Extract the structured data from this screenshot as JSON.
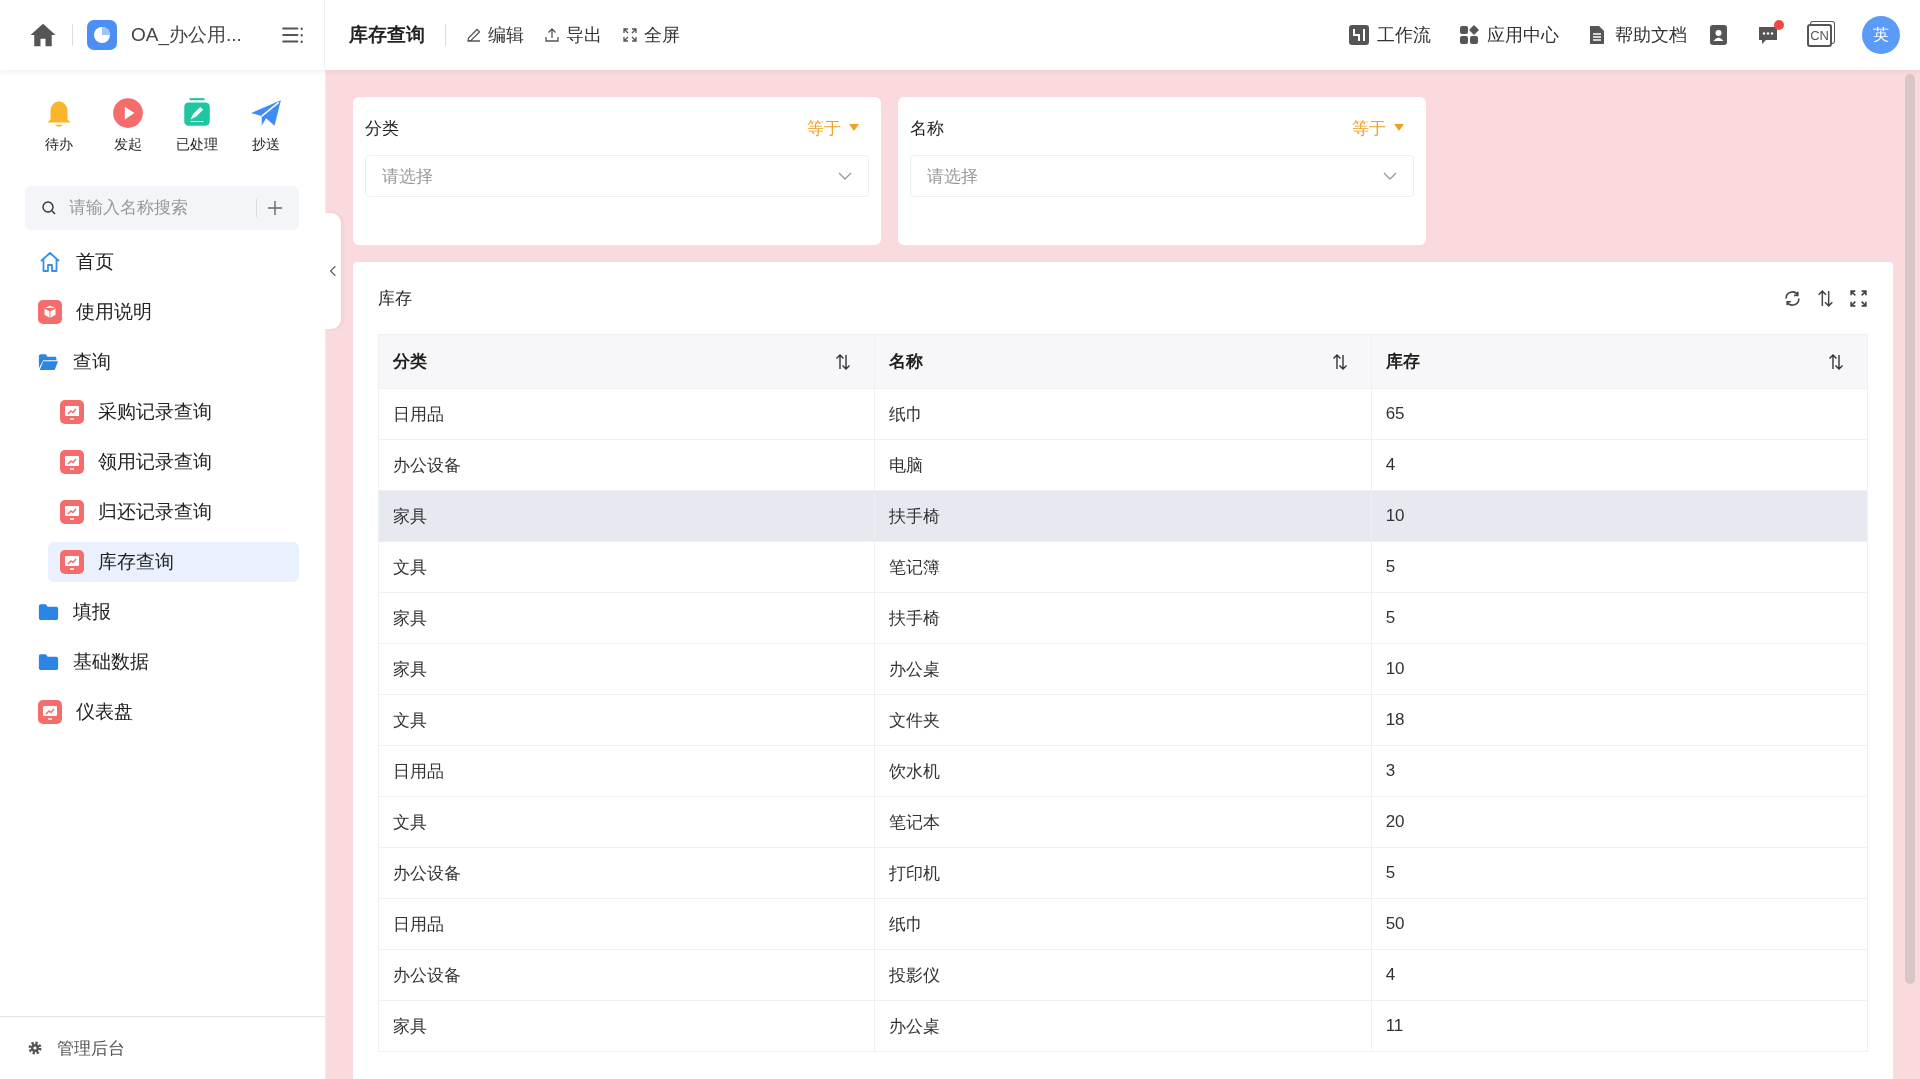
{
  "app": {
    "title": "OA_办公用..."
  },
  "page_title": "库存查询",
  "toolbar": [
    {
      "kind": "edit",
      "label": "编辑"
    },
    {
      "kind": "export",
      "label": "导出"
    },
    {
      "kind": "fullscreen",
      "label": "全屏"
    }
  ],
  "header_links": [
    {
      "kind": "workflow",
      "label": "工作流"
    },
    {
      "kind": "apps",
      "label": "应用中心"
    },
    {
      "kind": "docs",
      "label": "帮助文档"
    }
  ],
  "notifications": {
    "unread": true
  },
  "language": "CN",
  "avatar": "英",
  "quick_actions": [
    {
      "kind": "todo",
      "label": "待办",
      "color": "#fbb52b"
    },
    {
      "kind": "start",
      "label": "发起",
      "color": "#f56c6c"
    },
    {
      "kind": "done",
      "label": "已处理",
      "color": "#1fc6a0"
    },
    {
      "kind": "cc",
      "label": "抄送",
      "color": "#3f8cf7"
    }
  ],
  "sidebar": {
    "search": {
      "placeholder": "请输入名称搜索"
    },
    "items": [
      {
        "kind": "home",
        "label": "首页",
        "selected": false
      },
      {
        "kind": "doc",
        "label": "使用说明",
        "selected": false
      },
      {
        "kind": "folder",
        "label": "查询",
        "selected": false,
        "expanded": true,
        "children": [
          {
            "kind": "page",
            "label": "采购记录查询",
            "selected": false
          },
          {
            "kind": "page",
            "label": "领用记录查询",
            "selected": false
          },
          {
            "kind": "page",
            "label": "归还记录查询",
            "selected": false
          },
          {
            "kind": "page",
            "label": "库存查询",
            "selected": true
          }
        ]
      },
      {
        "kind": "folder",
        "label": "填报",
        "selected": false,
        "expanded": false
      },
      {
        "kind": "folder",
        "label": "基础数据",
        "selected": false,
        "expanded": false
      },
      {
        "kind": "page",
        "label": "仪表盘",
        "selected": false
      }
    ],
    "footer": "管理后台"
  },
  "filters": [
    {
      "label": "分类",
      "operator": "等于",
      "placeholder": "请选择"
    },
    {
      "label": "名称",
      "operator": "等于",
      "placeholder": "请选择"
    }
  ],
  "table": {
    "title": "库存",
    "columns": [
      "分类",
      "名称",
      "库存"
    ],
    "rows": [
      {
        "cells": [
          "日用品",
          "纸巾",
          "65"
        ],
        "highlighted": false
      },
      {
        "cells": [
          "办公设备",
          "电脑",
          "4"
        ],
        "highlighted": false
      },
      {
        "cells": [
          "家具",
          "扶手椅",
          "10"
        ],
        "highlighted": true
      },
      {
        "cells": [
          "文具",
          "笔记簿",
          "5"
        ],
        "highlighted": false
      },
      {
        "cells": [
          "家具",
          "扶手椅",
          "5"
        ],
        "highlighted": false
      },
      {
        "cells": [
          "家具",
          "办公桌",
          "10"
        ],
        "highlighted": false
      },
      {
        "cells": [
          "文具",
          "文件夹",
          "18"
        ],
        "highlighted": false
      },
      {
        "cells": [
          "日用品",
          "饮水机",
          "3"
        ],
        "highlighted": false
      },
      {
        "cells": [
          "文具",
          "笔记本",
          "20"
        ],
        "highlighted": false
      },
      {
        "cells": [
          "办公设备",
          "打印机",
          "5"
        ],
        "highlighted": false
      },
      {
        "cells": [
          "日用品",
          "纸巾",
          "50"
        ],
        "highlighted": false
      },
      {
        "cells": [
          "办公设备",
          "投影仪",
          "4"
        ],
        "highlighted": false
      },
      {
        "cells": [
          "家具",
          "办公桌",
          "11"
        ],
        "highlighted": false
      }
    ]
  }
}
